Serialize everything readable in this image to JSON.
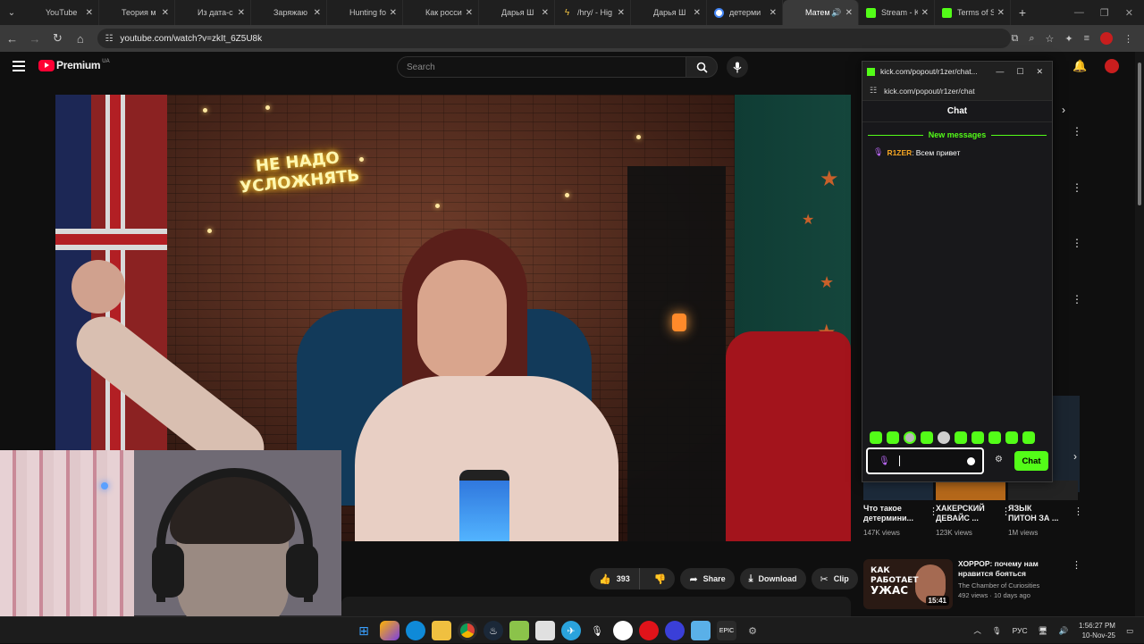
{
  "browser": {
    "tabs": [
      {
        "title": "YouTube",
        "favicon": "youtube-icon",
        "active": false
      },
      {
        "title": "Теория м",
        "favicon": "youtube-icon",
        "active": false
      },
      {
        "title": "Из дата-с",
        "favicon": "youtube-icon",
        "active": false
      },
      {
        "title": "Заряжаю",
        "favicon": "youtube-icon",
        "active": false
      },
      {
        "title": "Hunting fo",
        "favicon": "youtube-icon",
        "active": false
      },
      {
        "title": "Как росси",
        "favicon": "youtube-icon",
        "active": false
      },
      {
        "title": "Дарья Ш",
        "favicon": "youtube-icon",
        "active": false
      },
      {
        "title": "/hry/ - Hig",
        "favicon": "bolt-icon",
        "active": false
      },
      {
        "title": "Дарья Ш",
        "favicon": "youtube-icon",
        "active": false
      },
      {
        "title": "детерми",
        "favicon": "google-icon",
        "active": false
      },
      {
        "title": "Матем",
        "favicon": "youtube-icon",
        "active": true
      },
      {
        "title": "Stream - K",
        "favicon": "kick-icon",
        "active": false
      },
      {
        "title": "Terms of S",
        "favicon": "kick-icon",
        "active": false
      }
    ],
    "url": "youtube.com/watch?v=zkIt_6Z5U8k"
  },
  "youtube": {
    "logo_text": "Premium",
    "region_badge": "UA",
    "search_placeholder": "Search",
    "video": {
      "neon_line1": "НЕ НАДО",
      "neon_line2": "УСЛОЖНЯТЬ"
    },
    "actions": {
      "like_count": "393",
      "share_label": "Share",
      "download_label": "Download",
      "clip_label": "Clip"
    },
    "shorts": [
      {
        "title_line1": "Что такое",
        "title_line2": "детермини...",
        "views": "147K views"
      },
      {
        "title_line1": "ХАКЕРСКИЙ",
        "title_line2": "ДЕВАЙС ...",
        "views": "123K views"
      },
      {
        "title_line1": "ЯЗЫК",
        "title_line2": "ПИТОН ЗА ...",
        "views": "1M views"
      }
    ],
    "recommendation": {
      "thumb_line1": "КАК",
      "thumb_line2": "РАБОТАЕТ",
      "thumb_line3": "УЖАС",
      "duration": "15:41",
      "title": "ХОРРОР: почему нам нравится бояться",
      "channel": "The Chamber of Curiosities",
      "meta": "492 views · 10 days ago"
    }
  },
  "kick_popout": {
    "window_title": "kick.com/popout/r1zer/chat...",
    "url": "kick.com/popout/r1zer/chat",
    "header": "Chat",
    "new_messages_label": "New messages",
    "messages": [
      {
        "user": "R1ZER",
        "text": "Всем привет"
      }
    ],
    "send_label": "Chat",
    "accent_color": "#53fc18"
  },
  "taskbar": {
    "language": "РУС",
    "time": "1:56:27 PM",
    "date": "10-Nov-25"
  }
}
